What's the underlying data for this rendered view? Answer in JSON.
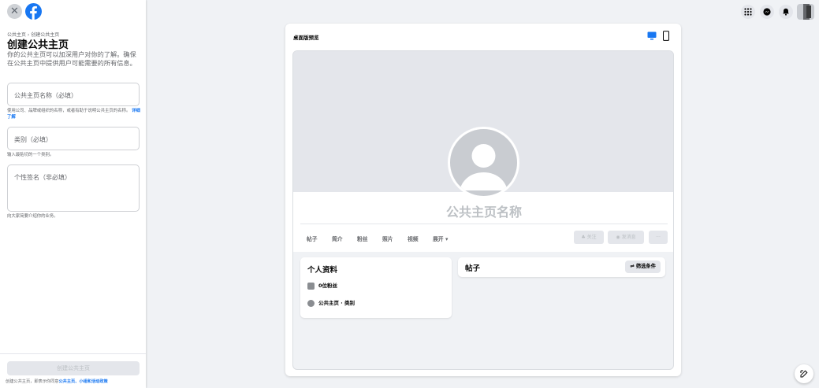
{
  "left_panel": {
    "close_glyph": "✕",
    "logo_icon": "facebook-logo",
    "breadcrumb": "公共主页 › 创建公共主页",
    "title": "创建公共主页",
    "description": "你的公共主页可以加深用户对你的了解。确保在公共主页中提供用户可能需要的所有信息。",
    "name_field": {
      "placeholder": "公共主页名称（必填）",
      "value": ""
    },
    "name_help": "使用公司、品牌或组织的名称，或者有助于说明公共主页的名称。",
    "name_help_link": "详细了解",
    "category_field": {
      "placeholder": "类别（必填）",
      "value": ""
    },
    "category_help": "输入最贴切的一个类别。",
    "bio_field": {
      "placeholder": "个性签名（非必填）",
      "value": ""
    },
    "bio_help": "向大家简要介绍你的业务。",
    "create_button": "创建公共主页",
    "terms_prefix": "创建公共主页，即表示你同意",
    "terms_link": "公共主页、小组和活动政策"
  },
  "top_icons": [
    "menu-grid-icon",
    "messenger-icon",
    "notifications-bell-icon",
    "account-avatar"
  ],
  "preview": {
    "title": "桌面版预览",
    "page_name": "公共主页名称",
    "tabs": [
      "帖子",
      "简介",
      "粉丝",
      "照片",
      "视频",
      "展开 ▾"
    ],
    "follow_button": "关注",
    "message_button": "发消息",
    "more_button": "···",
    "about_box": {
      "title": "个人资料",
      "followers": "0位粉丝",
      "category": "公共主页 · 类别"
    },
    "posts_box": {
      "title": "帖子",
      "filter_button": "筛选条件"
    }
  },
  "colors": {
    "brand": "#1877f2",
    "background": "#f0f2f5",
    "disabled": "#e4e6eb"
  }
}
